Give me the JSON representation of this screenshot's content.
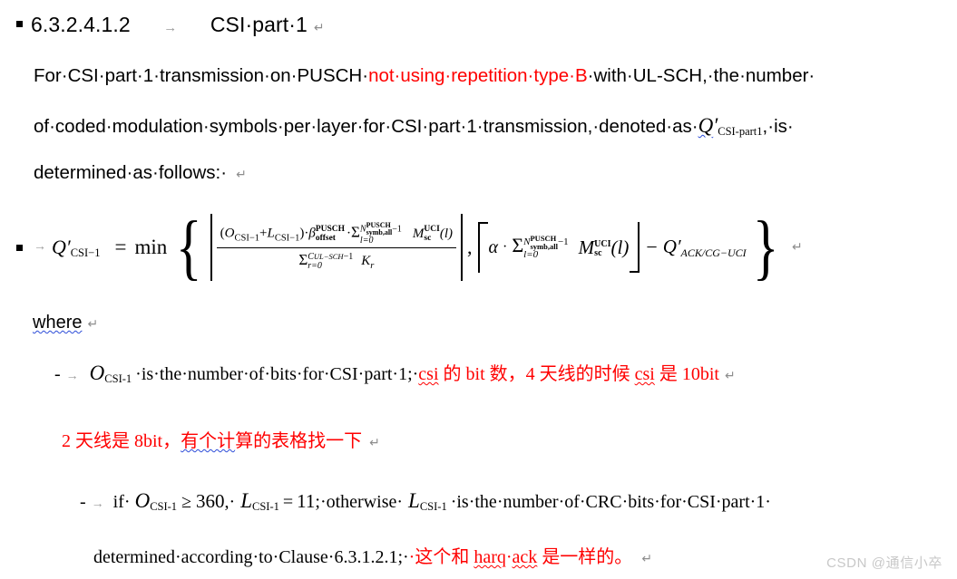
{
  "document": {
    "heading": {
      "number": "6.3.2.4.1.2",
      "tab_mark": "→",
      "title": "CSI·part·1",
      "paragraph_mark": "↵"
    },
    "paragraph": {
      "line1_pre": "For·CSI·part·1·transmission·on·PUSCH·",
      "line1_red": "not·using·repetition·type·B",
      "line1_post": "·with·UL-SCH,·the·number·",
      "line2_pre": "of·coded·modulation·symbols·per·layer·for·CSI·part·1·transmission,·denoted·as·",
      "line2_math_base": "Q",
      "line2_math_prime": "′",
      "line2_math_sub": "CSI-part1",
      "line2_post": ",·is·",
      "line3": "determined·as·follows:·",
      "line3_mark": "↵"
    },
    "formula": {
      "tab_mark": "→",
      "lhs_base": "Q",
      "lhs_prime": "′",
      "lhs_sub": "CSI−1",
      "equals": "=",
      "min": "min",
      "numerator": {
        "open_paren": "(",
        "o_base": "O",
        "o_sub": "CSI−1",
        "plus": "+",
        "l_base": "L",
        "l_sub": "CSI−1",
        "close_paren": ")·",
        "beta_base": "β",
        "beta_sup": "PUSCH",
        "beta_sub": "offset",
        "dot": "·",
        "sigma": "Σ",
        "sigma_sup_n": "N",
        "sigma_sup_n_sup": "PUSCH",
        "sigma_sup_n_sub": "symb,all",
        "sigma_sup_minus1": "−1",
        "sigma_sub": "l=0",
        "m_base": "M",
        "m_sup": "UCI",
        "m_sub": "sc",
        "m_arg": "(l)"
      },
      "denominator": {
        "sigma": "Σ",
        "sigma_sup_c": "C",
        "sigma_sup_c_sub": "UL−SCH",
        "sigma_sup_minus1": "−1",
        "sigma_sub": "r=0",
        "k_base": "K",
        "k_sub": "r"
      },
      "comma": ",",
      "second_term": {
        "alpha": "α",
        "dot": "·",
        "sigma": "Σ",
        "sigma_sup_n": "N",
        "sigma_sup_n_sup": "PUSCH",
        "sigma_sup_n_sub": "symb,all",
        "sigma_sup_minus1": "−1",
        "sigma_sub": "l=0",
        "m_base": "M",
        "m_sup": "UCI",
        "m_sub": "sc",
        "m_arg": "(l)"
      },
      "minus": "−",
      "subtracted": {
        "base": "Q",
        "prime": "′",
        "sub": "ACK/CG−UCI"
      },
      "paragraph_mark": "↵"
    },
    "where_label": {
      "text": "where",
      "paragraph_mark": "↵"
    },
    "list": {
      "item1": {
        "dash": "-",
        "tab_mark": "→",
        "var_base": "O",
        "var_sub": "CSI-1",
        "text": "·is·the·number·of·bits·for·CSI·part·1;·",
        "annotation_red": "csi",
        "annotation_red_rest": " 的 bit 数，4 天线的时候 ",
        "annotation_red2": "csi",
        "annotation_red_tail": " 是 10bit",
        "paragraph_mark": "↵"
      },
      "item_red_line": {
        "prefix": "2 天线是 8bit，",
        "squiggle": "有个计",
        "suffix": "算的表格找一下",
        "paragraph_mark": "↵"
      },
      "item2": {
        "dash": "-",
        "tab_mark": "→",
        "if_word": "if·",
        "o_base": "O",
        "o_sub": "CSI-1",
        "ge": "≥",
        "value": "360",
        "comma": ",·",
        "l_base": "L",
        "l_sub": "CSI-1",
        "equals": "=",
        "eleven": "11",
        "semicolon": ";·otherwise·",
        "l2_base": "L",
        "l2_sub": "CSI-1",
        "tail": "·is·the·number·of·CRC·bits·for·CSI·part·1·"
      },
      "item2_line2": {
        "text": "determined·according·to·Clause·6.3.1.2.1;·",
        "annotation_pre": "·这个和 ",
        "annotation_squiggle1": "harq",
        "annotation_mid": "·",
        "annotation_squiggle2": "ack",
        "annotation_post": " 是一样的。",
        "paragraph_mark": "↵"
      }
    }
  },
  "watermark": {
    "text": "CSDN @通信小卒"
  },
  "colors": {
    "emphasis_red": "#ff0000",
    "text_black": "#000000",
    "mark_gray": "#9a9a9a",
    "watermark_gray": "#c8c8c8",
    "spellcheck_blue": "#2b4bd8"
  }
}
